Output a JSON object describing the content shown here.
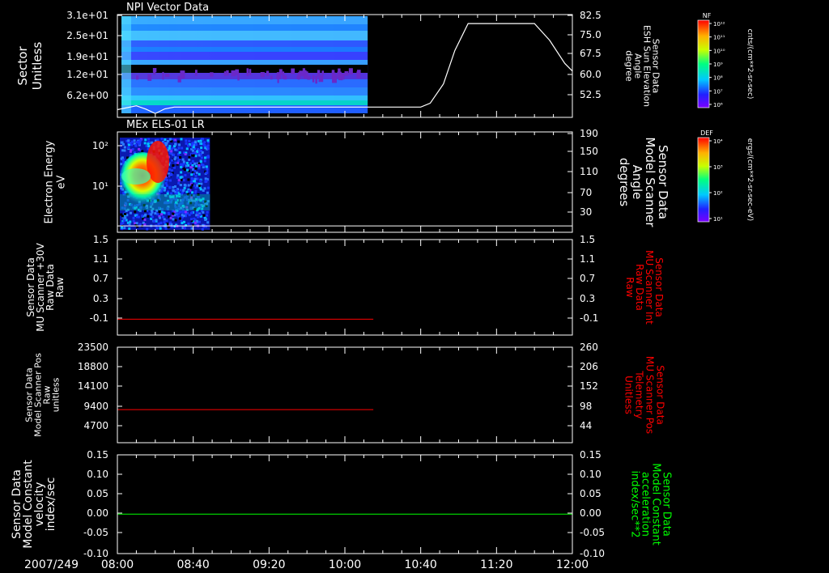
{
  "colors": {
    "background": "#000000",
    "foreground": "#ffffff",
    "red": "#ff0000",
    "green": "#00ff00"
  },
  "time_axis": {
    "date": "2007/249",
    "ticks": [
      "08:00",
      "08:40",
      "09:20",
      "10:00",
      "10:40",
      "11:20",
      "12:00"
    ]
  },
  "colorbars": [
    {
      "label": "NF",
      "units": "cnts/(cm**2-sr-sec)",
      "ticks": [
        "10¹²",
        "10¹¹",
        "10¹⁰",
        "10⁹",
        "10⁸",
        "10⁷",
        "10⁶"
      ]
    },
    {
      "label": "DEF",
      "units": "ergs/(cm**2-sr-sec-eV)",
      "ticks": [
        "10⁴",
        "10³",
        "10²",
        "10¹"
      ]
    }
  ],
  "chart_data": [
    {
      "type": "heatmap",
      "title": "NPI Vector Data",
      "ylabel": [
        "Sector",
        "Unitless"
      ],
      "yticks": [
        "3.1e+01",
        "2.5e+01",
        "1.9e+01",
        "1.2e+01",
        "6.2e+00"
      ],
      "right_ylabel": [
        "Sensor Data",
        "ESH Sun Elevation",
        "Angle",
        "degree"
      ],
      "right_yticks": [
        "82.5",
        "75.0",
        "67.5",
        "60.0",
        "52.5"
      ],
      "right_ylim": [
        45,
        85
      ],
      "heatmap_time_range": [
        "08:00",
        "10:12"
      ],
      "line_series": {
        "x": [
          "08:00",
          "08:10",
          "08:15",
          "08:20",
          "08:25",
          "08:30",
          "09:00",
          "10:00",
          "10:40",
          "10:45",
          "10:52",
          "10:58",
          "11:05",
          "11:40",
          "11:48",
          "11:56",
          "12:00"
        ],
        "y": [
          48.0,
          49.5,
          48.2,
          46.5,
          48.3,
          49.0,
          49.0,
          49.0,
          49.0,
          50.5,
          58.0,
          71.0,
          81.5,
          81.5,
          75.0,
          66.0,
          63.0
        ]
      }
    },
    {
      "type": "heatmap",
      "title": "MEx ELS-01 LR",
      "ylabel": [
        "Electron Energy",
        "eV"
      ],
      "yticks": [
        "10²",
        "10¹"
      ],
      "ylim": [
        1,
        200
      ],
      "yscale": "log",
      "right_ylabel": [
        "Sensor Data",
        "Model Scanner",
        "Angle",
        "degrees"
      ],
      "right_yticks": [
        "190",
        "150",
        "110",
        "70",
        "30"
      ],
      "right_ylim": [
        0,
        190
      ],
      "heatmap_time_range": [
        "08:00",
        "08:48"
      ],
      "line_series": {
        "x": [
          "08:00",
          "12:00"
        ],
        "y": [
          12,
          12
        ]
      }
    },
    {
      "type": "line",
      "ylabel": [
        "Sensor Data",
        "MU Scanner +30V",
        "Raw Data",
        "Raw"
      ],
      "yticks": [
        "1.5",
        "1.1",
        "0.7",
        "0.3",
        "-0.1"
      ],
      "ylim": [
        -0.3,
        1.5
      ],
      "right_ylabel": [
        "Sensor Data",
        "MU Scanner Int",
        "Raw Data",
        "Raw"
      ],
      "right_yticks": [
        "1.5",
        "1.1",
        "0.7",
        "0.3",
        "-0.1"
      ],
      "series": [
        {
          "color": "#ff0000",
          "x": [
            "08:00",
            "10:15"
          ],
          "y": [
            0.0,
            0.0
          ]
        }
      ]
    },
    {
      "type": "line",
      "ylabel": [
        "Sensor Data",
        "Model Scanner Pos",
        "Raw",
        "unitless"
      ],
      "yticks": [
        "23500",
        "18800",
        "14100",
        "9400",
        "4700"
      ],
      "ylim": [
        0,
        23500
      ],
      "right_ylabel": [
        "Sensor Data",
        "MU Scanner Pos",
        "Telemetry",
        "Unitless"
      ],
      "right_yticks": [
        "260",
        "206",
        "152",
        "98",
        "44"
      ],
      "right_ylim": [
        0,
        260
      ],
      "series": [
        {
          "color": "#ff0000",
          "axis": "right",
          "x": [
            "08:00",
            "10:15"
          ],
          "y": [
            90,
            90
          ]
        }
      ]
    },
    {
      "type": "line",
      "ylabel": [
        "Sensor Data",
        "Model Constant",
        "velocity",
        "index/sec"
      ],
      "yticks": [
        "0.15",
        "0.10",
        "0.05",
        "0.00",
        "-0.05",
        "-0.10"
      ],
      "ylim": [
        -0.1,
        0.15
      ],
      "right_ylabel": [
        "Sensor Data",
        "Model Constant",
        "acceleration",
        "index/sec**2"
      ],
      "right_yticks": [
        "0.15",
        "0.10",
        "0.05",
        "0.00",
        "-0.05",
        "-0.10"
      ],
      "series": [
        {
          "color": "#00ff00",
          "x": [
            "08:00",
            "12:00"
          ],
          "y": [
            0.0,
            0.0
          ]
        }
      ]
    }
  ]
}
